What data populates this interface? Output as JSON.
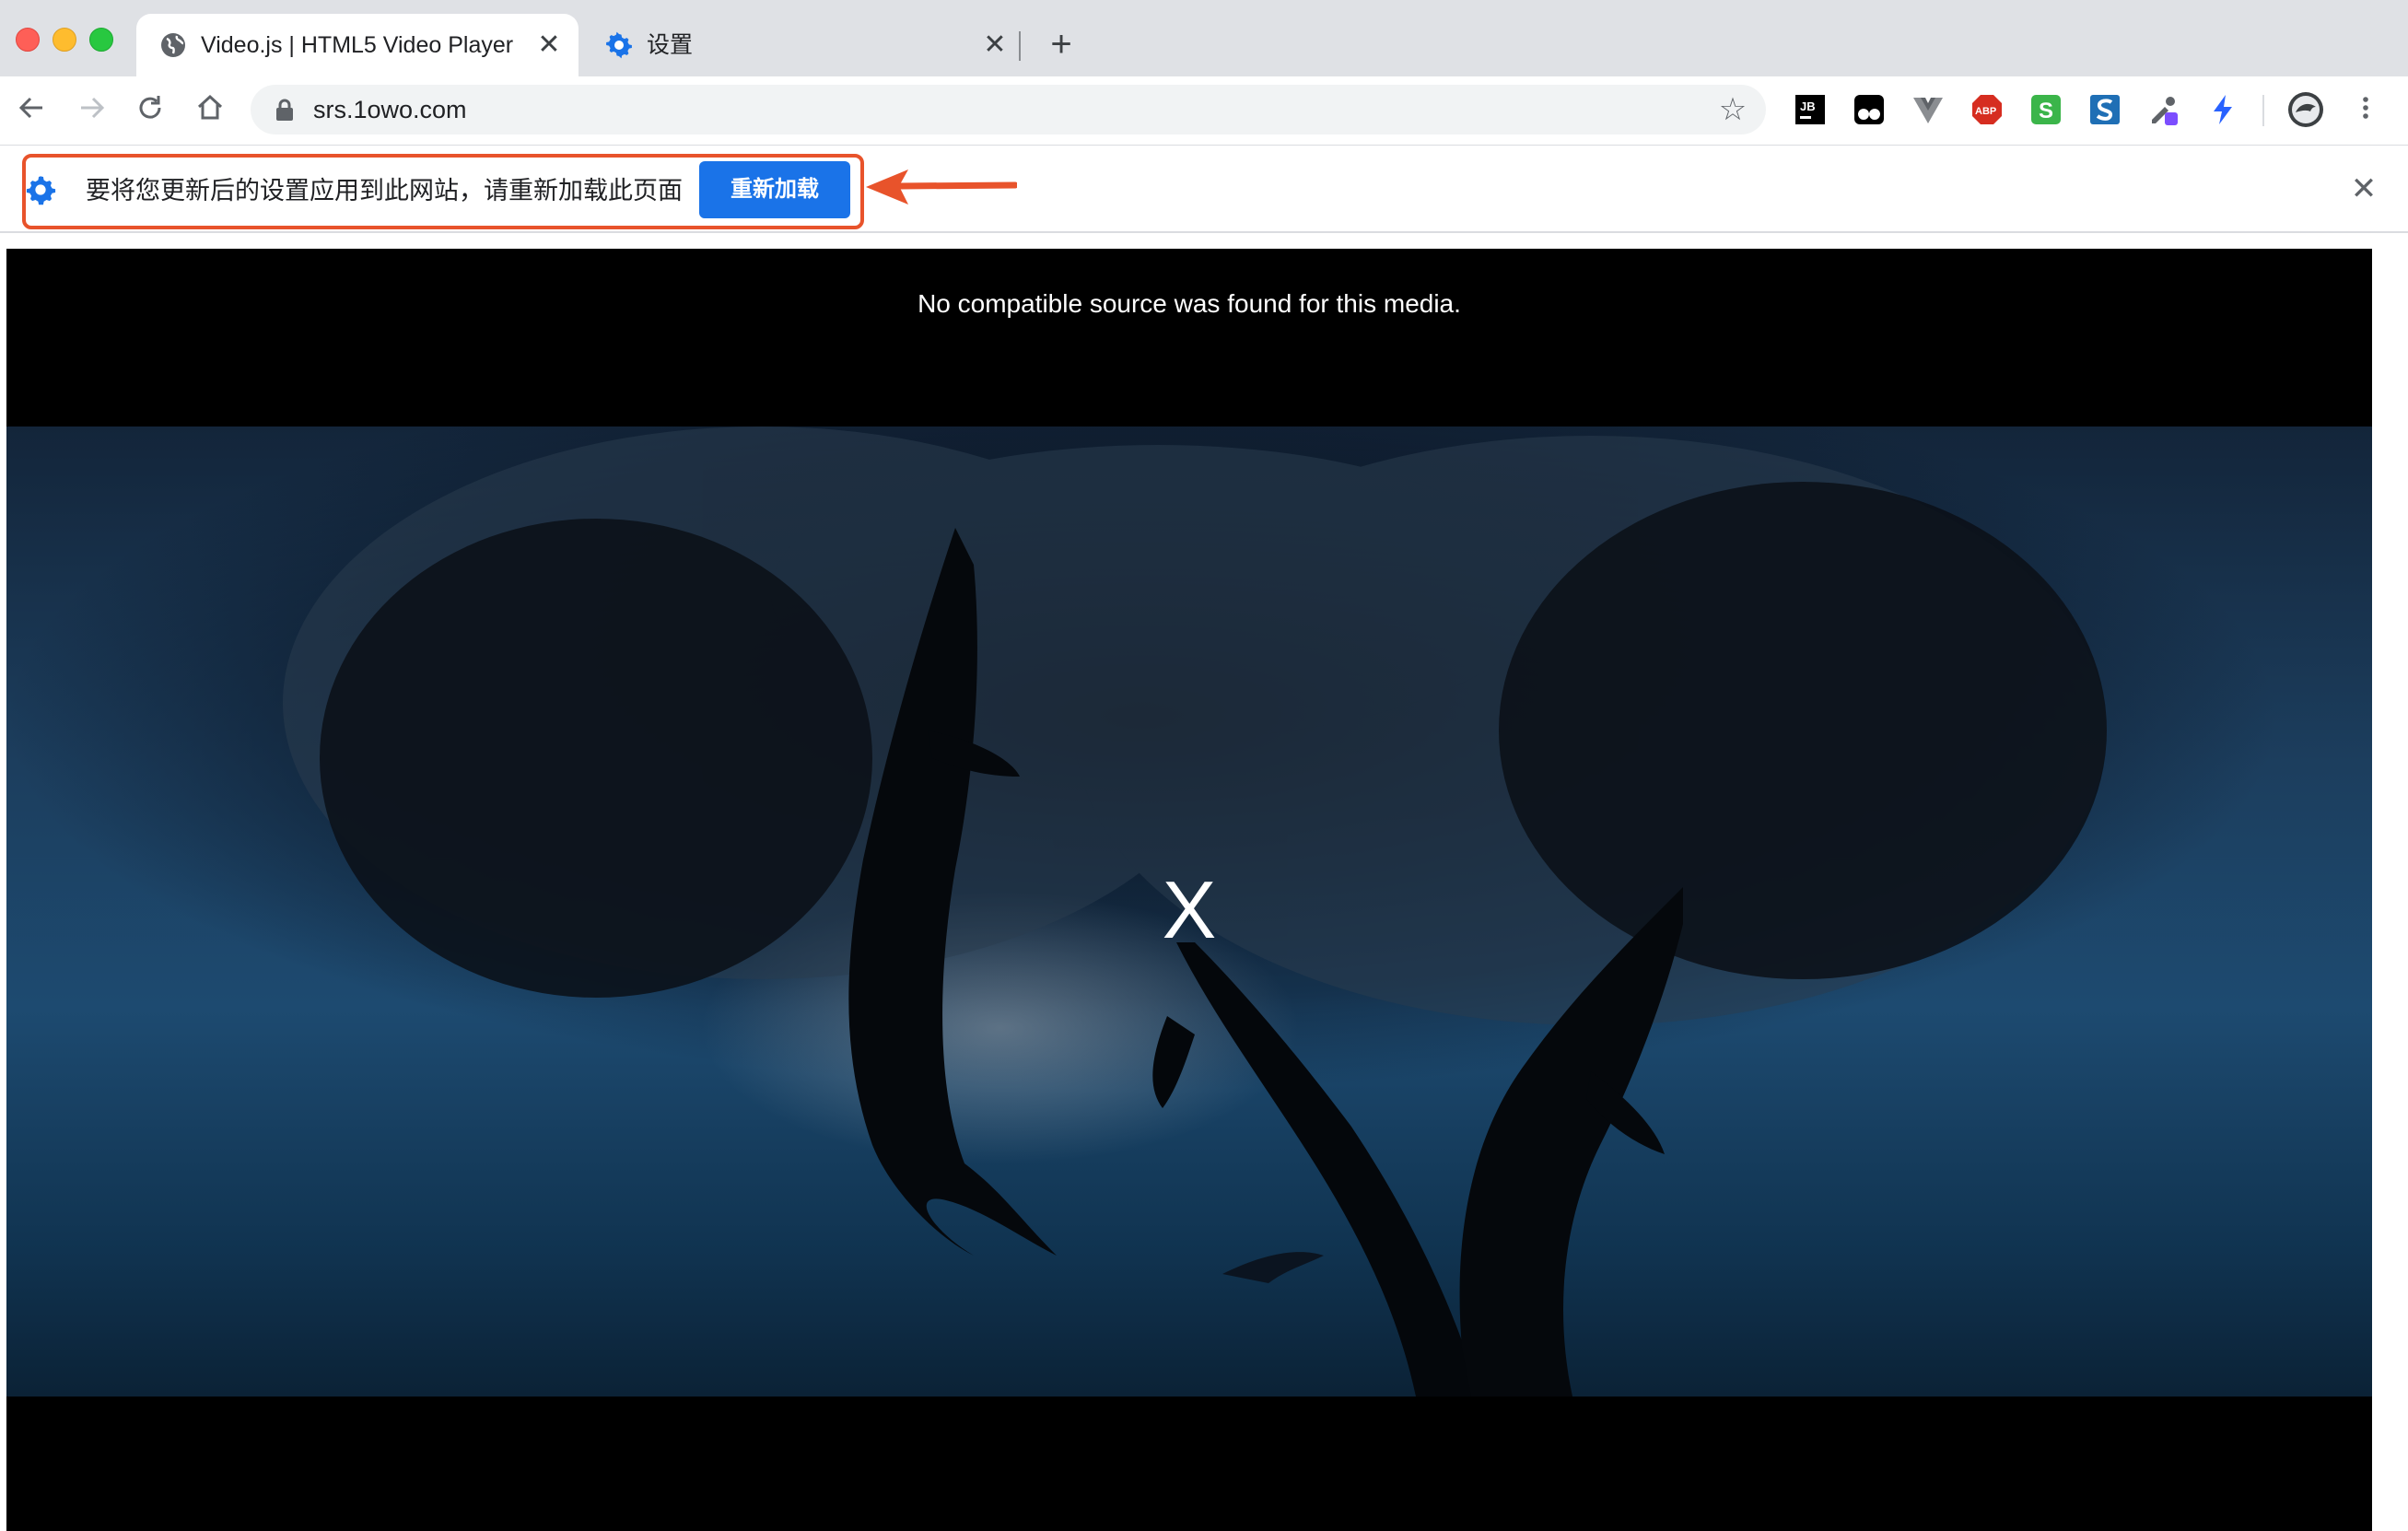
{
  "window": {
    "tabs": [
      {
        "title": "Video.js | HTML5 Video Player",
        "favicon": "globe-icon",
        "active": true
      },
      {
        "title": "设置",
        "favicon": "gear-icon",
        "active": false
      }
    ]
  },
  "toolbar": {
    "url": "srs.1owo.com",
    "extensions": [
      "jetbrains-icon",
      "tampermonkey-icon",
      "vue-devtools-icon",
      "adblock-plus-icon",
      "s-extension-icon",
      "s-blue-extension-icon",
      "eyedropper-icon",
      "lightning-icon"
    ],
    "profile": "avatar-icon"
  },
  "infobar": {
    "message": "要将您更新后的设置应用到此网站，请重新加载此页面",
    "reload_label": "重新加载",
    "highlight_color": "#e8532b",
    "button_color": "#1a73e8"
  },
  "video": {
    "error_message": "No compatible source was found for this media.",
    "error_glyph": "X"
  }
}
